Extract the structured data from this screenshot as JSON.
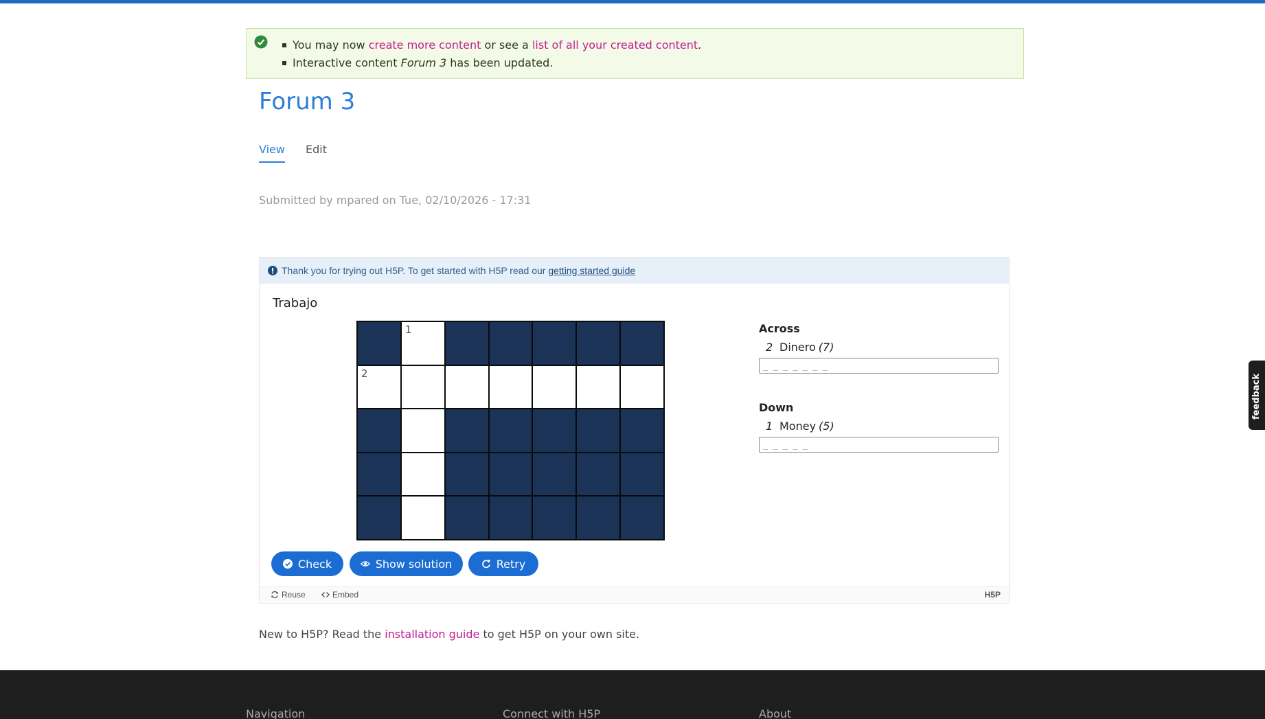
{
  "messages": {
    "line1_prefix": "You may now ",
    "line1_link1": "create more content",
    "line1_middle": " or see a ",
    "line1_link2": "list of all your created content",
    "line1_suffix": ".",
    "line2_prefix": "Interactive content ",
    "line2_item": "Forum 3",
    "line2_suffix": " has been updated."
  },
  "page": {
    "title": "Forum 3",
    "tabs": [
      {
        "label": "View",
        "active": true
      },
      {
        "label": "Edit",
        "active": false
      }
    ],
    "submitted": "Submitted by mpared on Tue, 02/10/2026 - 17:31"
  },
  "h5p": {
    "notice_text": "Thank you for trying out H5P. To get started with H5P read our ",
    "notice_link": "getting started guide",
    "title": "Trabajo",
    "grid_rows": 5,
    "grid_cols": 7,
    "open_cells": [
      [
        0,
        1
      ],
      [
        1,
        0
      ],
      [
        1,
        1
      ],
      [
        1,
        2
      ],
      [
        1,
        3
      ],
      [
        1,
        4
      ],
      [
        1,
        5
      ],
      [
        1,
        6
      ],
      [
        2,
        1
      ],
      [
        3,
        1
      ],
      [
        4,
        1
      ]
    ],
    "cell_numbers": [
      {
        "row": 0,
        "col": 1,
        "label": "1"
      },
      {
        "row": 1,
        "col": 0,
        "label": "2"
      }
    ],
    "across": {
      "heading": "Across",
      "clue": {
        "number": "2",
        "text": "Dinero",
        "length": "(7)",
        "placeholder": "_ _ _ _ _ _ _"
      }
    },
    "down": {
      "heading": "Down",
      "clue": {
        "number": "1",
        "text": "Money",
        "length": "(5)",
        "placeholder": "_ _ _ _ _"
      }
    },
    "buttons": {
      "check": "Check",
      "show_solution": "Show solution",
      "retry": "Retry"
    },
    "footer": {
      "reuse": "Reuse",
      "embed": "Embed",
      "logo": "H5P"
    }
  },
  "new_to": {
    "prefix": "New to H5P? Read the ",
    "link": "installation guide",
    "suffix": " to get H5P on your own site."
  },
  "footer": {
    "columns": [
      "Navigation",
      "Connect with H5P",
      "About"
    ]
  },
  "feedback_tab": "feedback",
  "colors": {
    "accent": "#1b6dd4",
    "link_pink": "#c21a8f",
    "grid_dark": "#1a3356"
  }
}
